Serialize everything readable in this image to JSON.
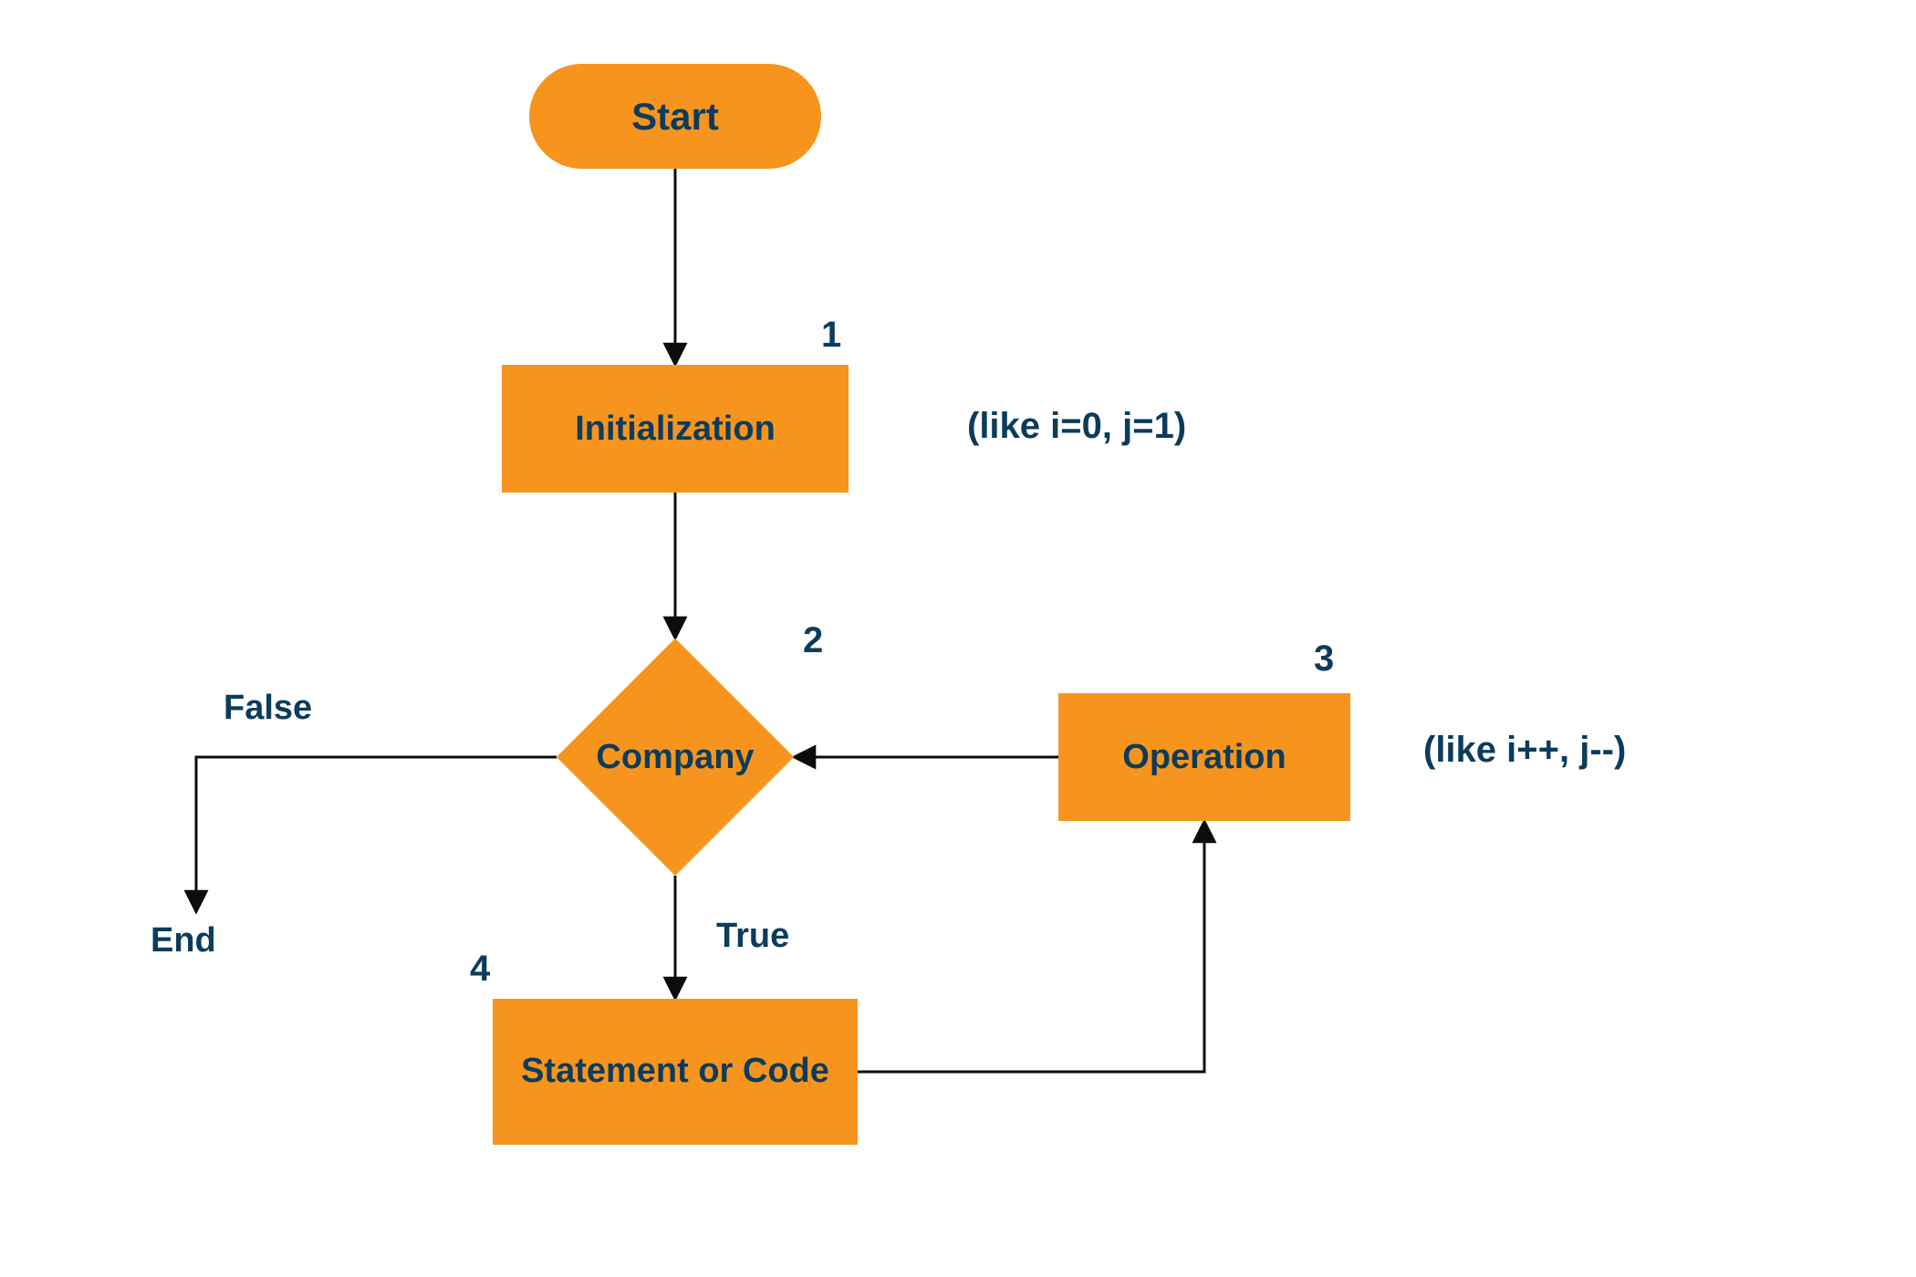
{
  "colors": {
    "node_fill": "#f7941d",
    "text_dark": "#0c3c5c",
    "edge": "#0c0c0c"
  },
  "nodes": {
    "start": {
      "label": "Start",
      "type": "terminator"
    },
    "init": {
      "label": "Initialization",
      "type": "process",
      "number": "1",
      "annotation": "(like i=0, j=1)"
    },
    "decision": {
      "label": "Company",
      "type": "decision",
      "number": "2"
    },
    "operation": {
      "label": "Operation",
      "type": "process",
      "number": "3",
      "annotation": "(like i++, j--)"
    },
    "statement": {
      "label": "Statement or Code",
      "type": "process",
      "number": "4"
    }
  },
  "edges": {
    "false_label": "False",
    "true_label": "True",
    "end_label": "End"
  }
}
